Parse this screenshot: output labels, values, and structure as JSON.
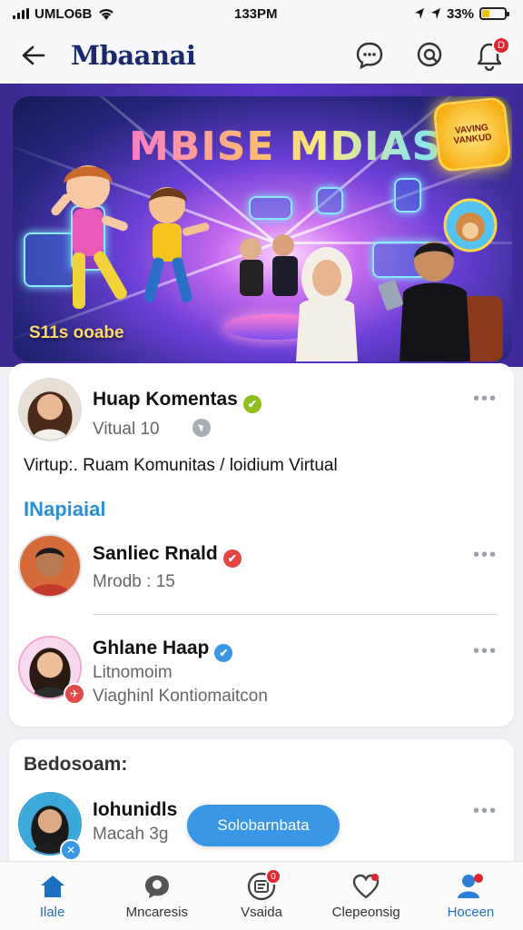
{
  "status": {
    "carrier": "UMLO6B",
    "time": "133PM",
    "battery": "33%",
    "battery_level": 0.33
  },
  "header": {
    "logo": "Mbaanai",
    "notif_badge": "D"
  },
  "banner": {
    "title": "MBISE MDIAS",
    "sticker": "VAVING VANKUD",
    "caption": "S11s ooabe"
  },
  "post": {
    "author": "Huap Komentas",
    "meta": "Vitual 10",
    "description": "Virtup:. Ruam Komunitas / loidium Virtual"
  },
  "section_title": "INapiaial",
  "members": [
    {
      "name": "Sanliec Rnald",
      "detail": "Mrodb : 15"
    },
    {
      "name": "Ghlane Haap",
      "detail": "Litnomoim",
      "detail2": "Viaghinl Kontiomaitcon"
    }
  ],
  "recommend": {
    "title": "Bedosoam:",
    "name": "Iohunidls",
    "detail": "Macah 3g",
    "button": "Solobarnbata"
  },
  "nav": [
    {
      "label": "Ilale",
      "icon": "home-icon"
    },
    {
      "label": "Mncaresis",
      "icon": "chat-icon"
    },
    {
      "label": "Vsaida",
      "icon": "feed-icon",
      "badge": "0"
    },
    {
      "label": "Clepeonsig",
      "icon": "heart-icon"
    },
    {
      "label": "Hoceen",
      "icon": "profile-icon"
    }
  ],
  "colors": {
    "accent": "#2b8fd6",
    "brand": "#1a2a6c",
    "alert": "#e0262e"
  }
}
